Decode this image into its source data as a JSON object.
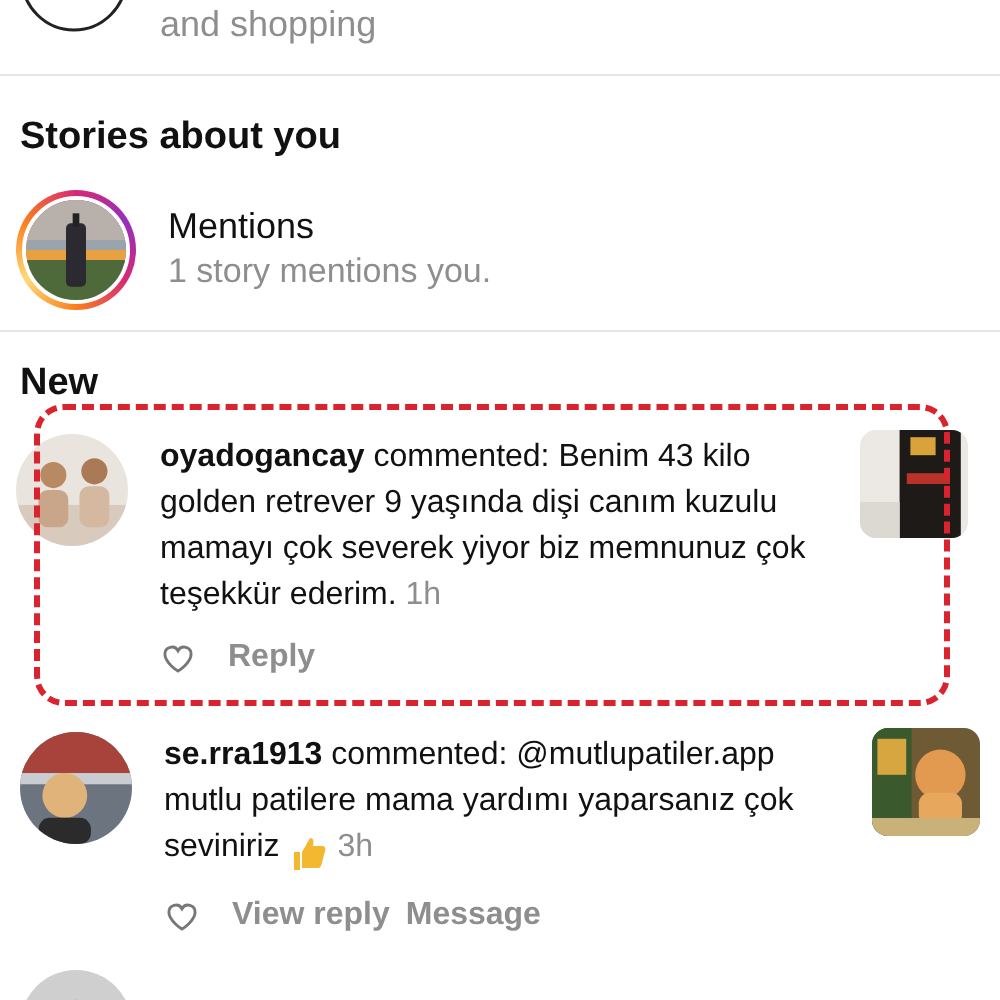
{
  "top_item": {
    "text": "and shopping"
  },
  "sections": [
    {
      "title": "Stories about you",
      "items": [
        {
          "kind": "story",
          "title": "Mentions",
          "subtitle": "1 story mentions you.",
          "unseen": true
        }
      ]
    },
    {
      "title": "New",
      "items": [
        {
          "kind": "comment",
          "username": "oyadogancay",
          "text": "commented: Benim 43 kilo golden retrever 9 yaşında dişi canım kuzulu mamayı çok severek yiyor biz memnunuz çok teşekkür ederim.",
          "thumbs_up": false,
          "time": "1h",
          "highlighted": true,
          "actions": [
            "Reply"
          ]
        },
        {
          "kind": "comment",
          "username": "se.rra1913",
          "text": "commented: @mutlupatiler.app mutlu patilere mama yardımı yaparsanız çok seviniriz",
          "thumbs_up": true,
          "time": "3h",
          "highlighted": false,
          "actions": [
            "View reply",
            "Message"
          ]
        },
        {
          "kind": "partial"
        }
      ]
    }
  ]
}
